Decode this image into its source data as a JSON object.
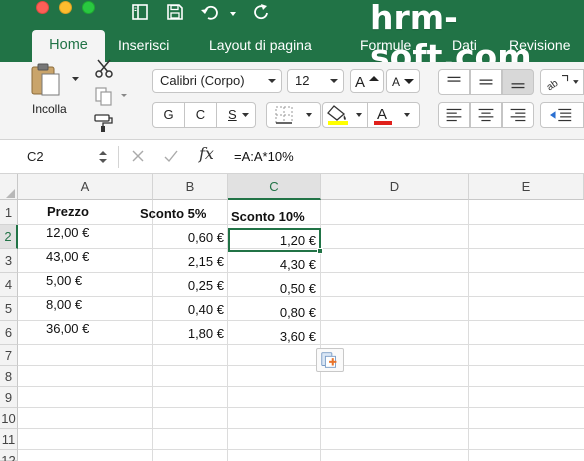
{
  "watermark": "hrm-soft.com",
  "ribbon_tabs": {
    "home": "Home",
    "insert": "Inserisci",
    "layout": "Layout di pagina",
    "formulas": "Formule",
    "data": "Dati",
    "review": "Revisione"
  },
  "clipboard": {
    "paste_label": "Incolla"
  },
  "font": {
    "name": "Calibri (Corpo)",
    "size": "12",
    "bold_label": "G",
    "italic_label": "C",
    "underline_label": "S"
  },
  "colors": {
    "accent": "#217346",
    "highlight": "#ffff00",
    "font_color": "#e0201b"
  },
  "formula_bar": {
    "name_box": "C2",
    "fx_label": "fx",
    "formula": "=A:A*10%"
  },
  "grid": {
    "columns": [
      "A",
      "B",
      "C",
      "D",
      "E"
    ],
    "selected_column": "C",
    "rows": [
      "1",
      "2",
      "3",
      "4",
      "5",
      "6",
      "7",
      "8",
      "9",
      "10",
      "11",
      "12"
    ],
    "selected_row": "2",
    "headers": {
      "a": "Prezzo",
      "b": "Sconto 5%",
      "c": "Sconto 10%"
    },
    "data": [
      {
        "a": "12,00 €",
        "b": "0,60 €",
        "c": "1,20 €"
      },
      {
        "a": "43,00 €",
        "b": "2,15 €",
        "c": "4,30 €"
      },
      {
        "a": "5,00 €",
        "b": "0,25 €",
        "c": "0,50 €"
      },
      {
        "a": "8,00 €",
        "b": "0,40 €",
        "c": "0,80 €"
      },
      {
        "a": "36,00 €",
        "b": "1,80 €",
        "c": "3,60 €"
      }
    ]
  },
  "icons": {
    "close": "window-close-icon",
    "minimize": "window-minimize-icon",
    "maximize": "window-maximize-icon",
    "sidebar": "sidebar-toggle-icon",
    "save": "save-icon",
    "undo": "undo-icon",
    "redo": "redo-icon",
    "paste": "paste-icon",
    "cut": "scissors-icon",
    "copy": "copy-icon",
    "format_painter": "format-painter-icon",
    "borders": "borders-icon",
    "fill_color": "fill-bucket-icon",
    "font_color": "font-color-icon",
    "paste_options": "paste-options-icon"
  }
}
